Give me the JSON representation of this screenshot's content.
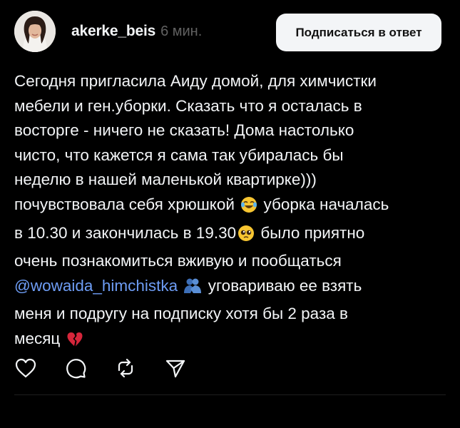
{
  "post": {
    "author": {
      "username": "akerke_beis",
      "time_ago": "6 мин."
    },
    "reply_button_label": "Подписаться в ответ",
    "text_lines": {
      "l1": "Сегодня пригласила Аиду домой, для химчистки",
      "l2": "мебели и ген.уборки. Сказать что я осталась в",
      "l3": "восторге - ничего не сказать! Дома настолько",
      "l4": "чисто, что кажется я сама так убиралась бы",
      "l5": "неделю в нашей маленькой квартирке)))",
      "l6a": "почувствовала себя хрюшкой",
      "l6b": "уборка началась",
      "l7a": "в 10.30 и закончилась в 19.30",
      "l7b": "было приятно",
      "l8": "очень познакомиться вживую и пообщаться",
      "l9_mention": "@wowaida_himchistka",
      "l9b": "уговариваю ее взять",
      "l10": "меня и подругу на подписку хотя бы 2 раза в",
      "l11": "месяц"
    },
    "emojis": [
      "face-with-tears-of-joy",
      "pleading-face",
      "people-hugging",
      "broken-heart"
    ],
    "actions": [
      "like",
      "comment",
      "repost",
      "share"
    ]
  },
  "colors": {
    "background": "#000000",
    "text": "#f3f5f7",
    "muted": "#616161",
    "mention": "#6e9df5",
    "button_bg": "#f3f5f7"
  }
}
